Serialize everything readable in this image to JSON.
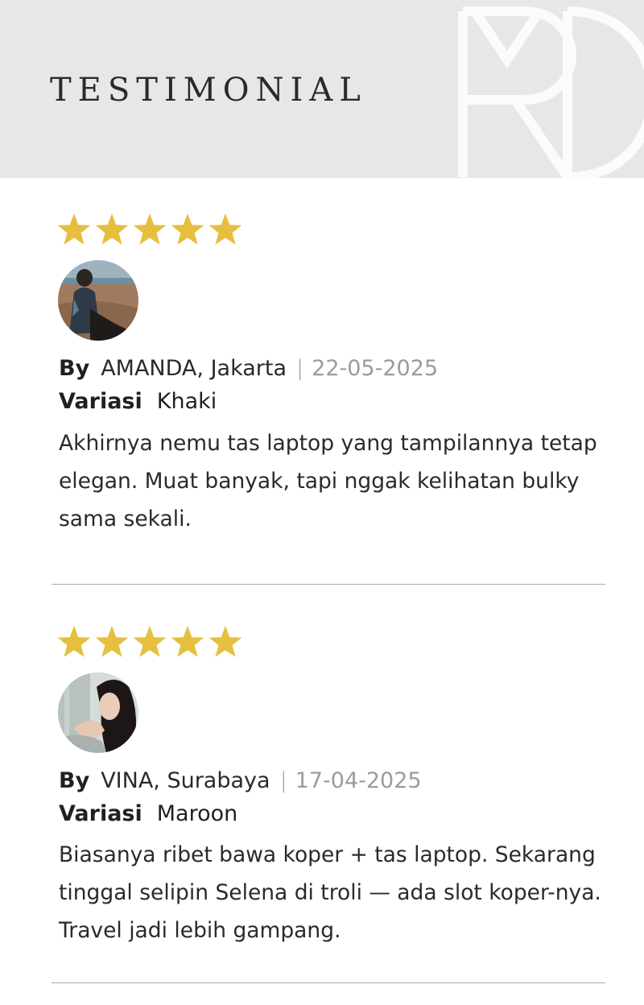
{
  "header": {
    "title": "TESTIMONIAL"
  },
  "colors": {
    "header_bg": "#e7e7e7",
    "star_gold": "#e6bf3f",
    "divider": "#a9a9a9"
  },
  "reviews": [
    {
      "rating": 5,
      "by_label": "By",
      "name": "AMANDA, Jakarta",
      "date": "22-05-2025",
      "variant_label": "Variasi",
      "variant": "Khaki",
      "text": "Akhirnya nemu tas laptop yang tampilannya tetap elegan. Muat banyak, tapi nggak kelihatan bulky sama sekali."
    },
    {
      "rating": 5,
      "by_label": "By",
      "name": "VINA, Surabaya",
      "date": "17-04-2025",
      "variant_label": "Variasi",
      "variant": "Maroon",
      "text": "Biasanya ribet bawa koper + tas laptop. Sekarang tinggal selipin Selena di troli — ada slot koper-nya. Travel jadi lebih gampang."
    }
  ]
}
